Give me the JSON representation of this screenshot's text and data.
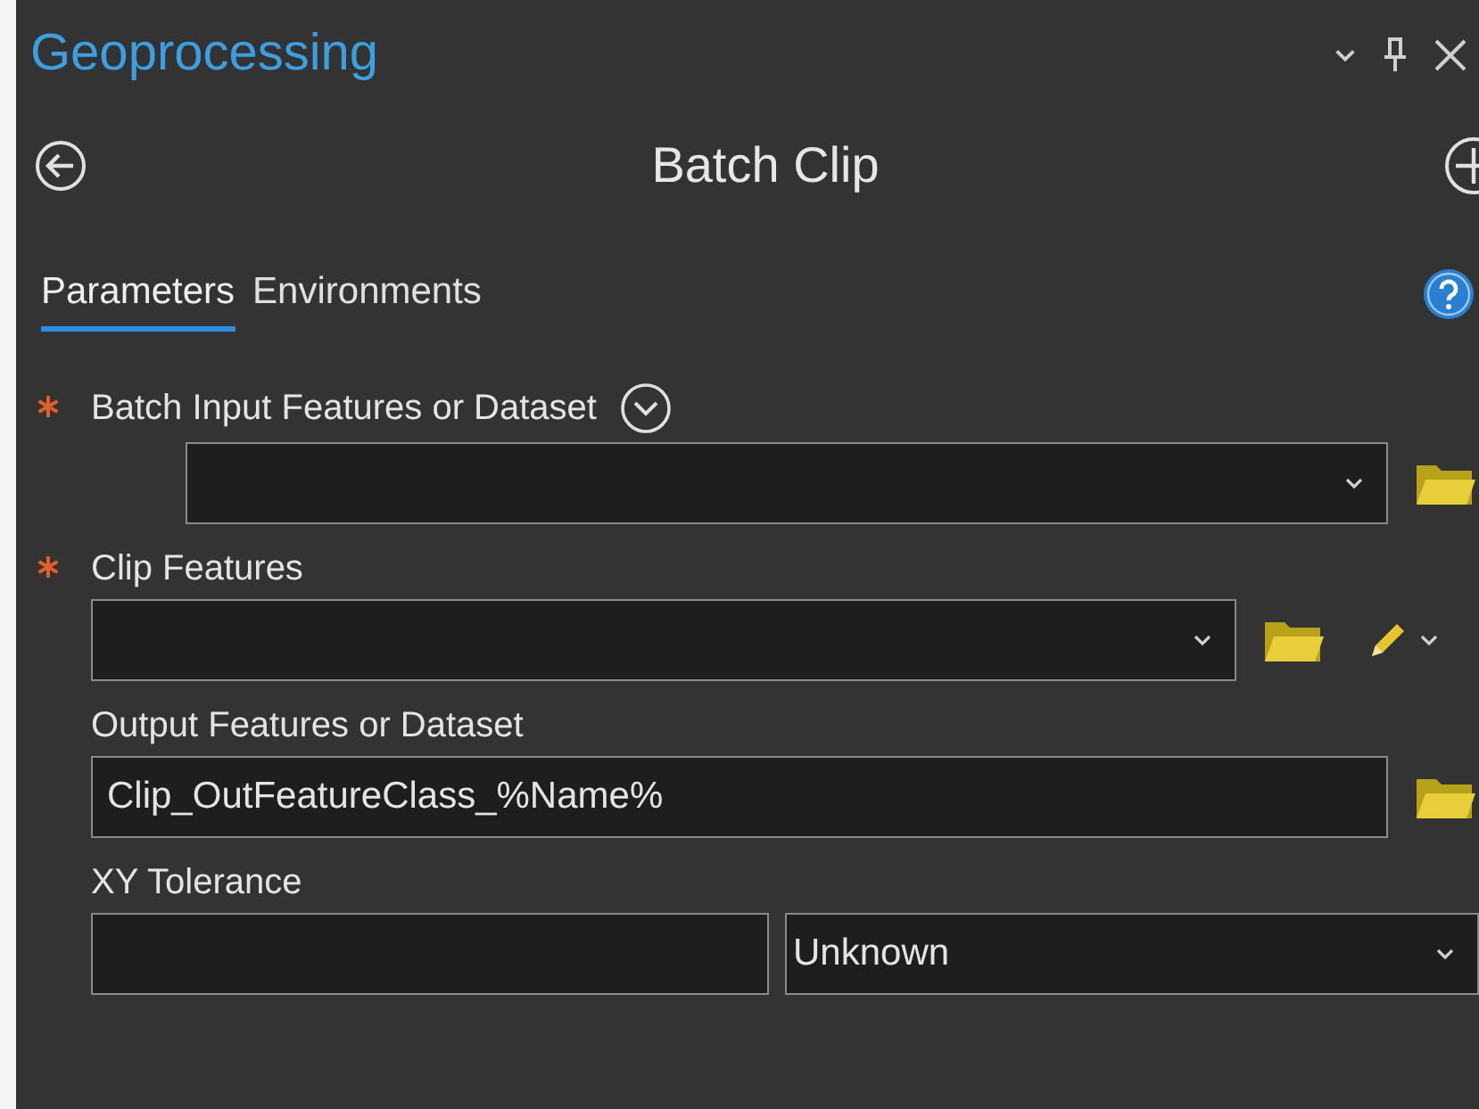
{
  "window": {
    "title": "Geoprocessing"
  },
  "header": {
    "title": "Batch Clip"
  },
  "tabs": [
    {
      "label": "Parameters",
      "selected": true
    },
    {
      "label": "Environments",
      "selected": false
    }
  ],
  "parameters": [
    {
      "kind": "batch",
      "label": "Batch Input Features or Dataset",
      "required": true,
      "expandable": true
    },
    {
      "kind": "feature",
      "label": "Clip Features",
      "required": true
    },
    {
      "kind": "output",
      "label": "Output Features or Dataset",
      "required": false,
      "value": "Clip_OutFeatureClass_%Name%"
    },
    {
      "kind": "unit",
      "label": "XY Tolerance",
      "required": false,
      "unit": "Unknown"
    }
  ]
}
